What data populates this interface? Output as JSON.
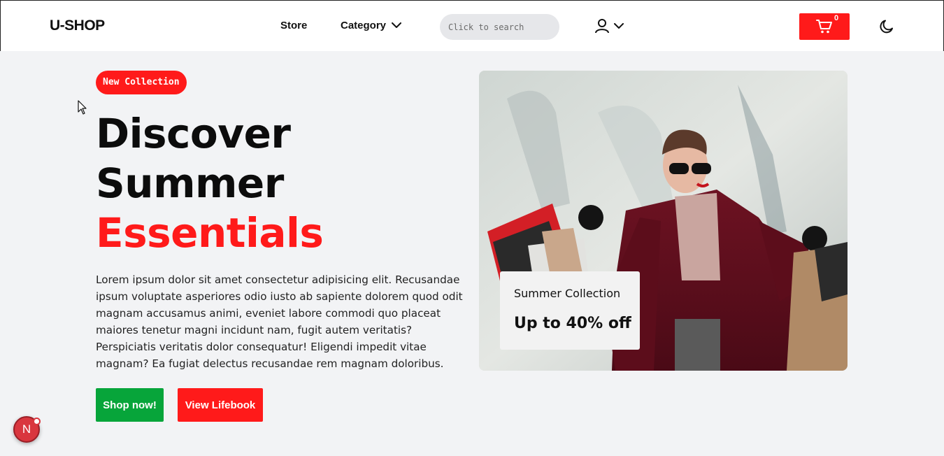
{
  "header": {
    "logo": "U-SHOP",
    "nav": {
      "store": "Store",
      "category": "Category"
    },
    "search_placeholder": "Click to search",
    "cart_count": "0",
    "icons": {
      "user": "user-icon",
      "chevron": "chevron-down-icon",
      "cart": "cart-icon",
      "theme": "moon-icon"
    }
  },
  "hero": {
    "badge": "New Collection",
    "title_line1": "Discover",
    "title_line2": "Summer",
    "title_line3": "Essentials",
    "description": "Lorem ipsum dolor sit amet consectetur adipisicing elit. Recusandae ipsum voluptate asperiores odio iusto ab sapiente dolorem quod odit magnam accusamus animi, eveniet labore commodi quo placeat maiores tenetur magni incidunt nam, fugit autem veritatis? Perspiciatis veritatis dolor consequatur! Eligendi impedit vitae magnam? Ea fugiat delectus recusandae rem magnam doloribus.",
    "buttons": {
      "primary": "Shop now!",
      "secondary": "View Lifebook"
    }
  },
  "promo": {
    "subtitle": "Summer Collection",
    "headline": "Up to 40% off"
  },
  "floating": {
    "avatar_letter": "N"
  },
  "colors": {
    "accent": "#ff1a1a",
    "green": "#07a53a",
    "background": "#f2f3f5"
  }
}
